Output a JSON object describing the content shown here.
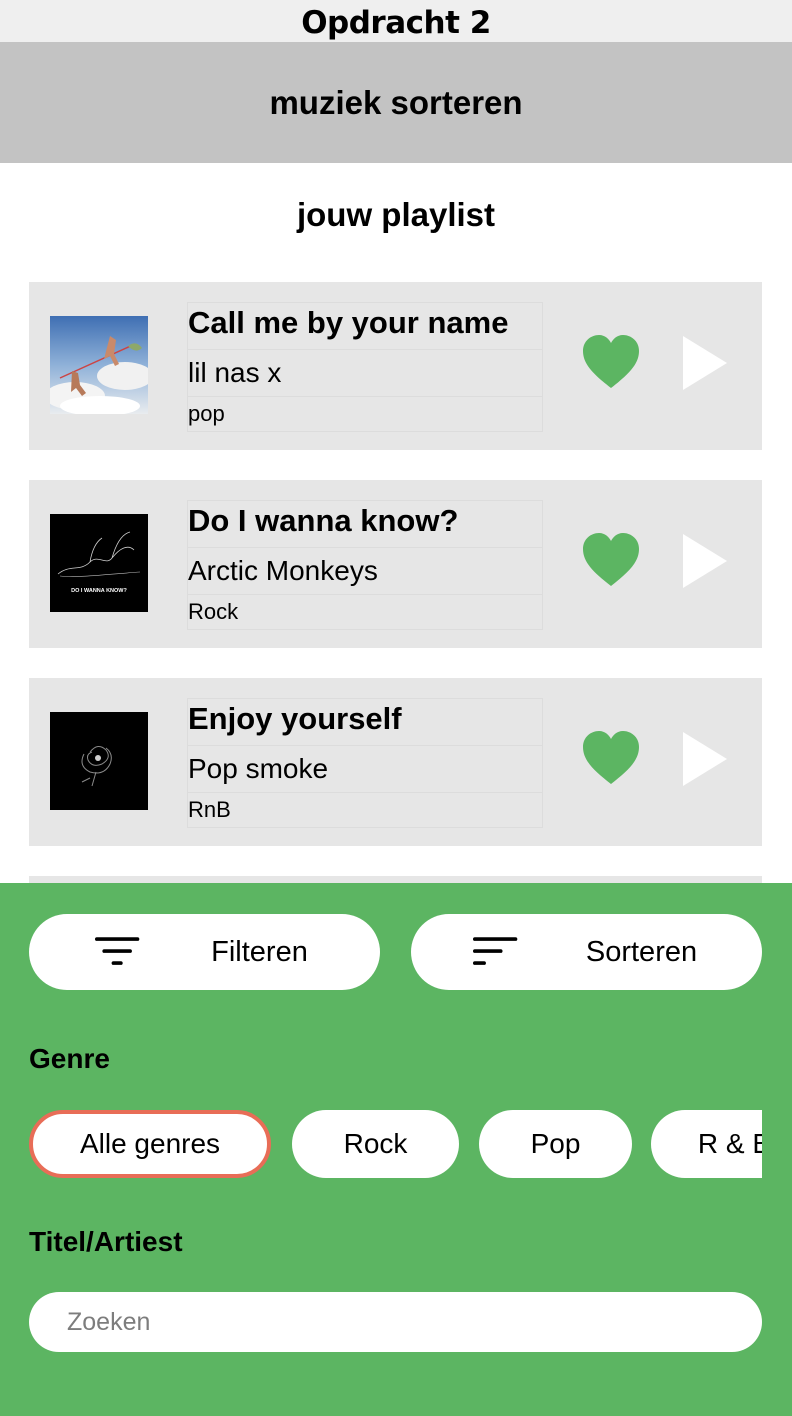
{
  "window": {
    "title": "Opdracht 2"
  },
  "header": {
    "title": "muziek sorteren"
  },
  "playlist": {
    "title": "jouw playlist",
    "songs": [
      {
        "title": "Call me by your name",
        "artist": "lil nas x",
        "genre": "pop",
        "cover": "sky-figures-cover"
      },
      {
        "title": "Do I wanna know?",
        "artist": "Arctic Monkeys",
        "genre": "Rock",
        "cover": "black-line-figure-cover",
        "cover_text": "DO I WANNA KNOW?"
      },
      {
        "title": "Enjoy yourself",
        "artist": "Pop smoke",
        "genre": "RnB",
        "cover": "black-rose-cover"
      }
    ]
  },
  "controls": {
    "filter_label": "Filteren",
    "sort_label": "Sorteren",
    "genre_heading": "Genre",
    "genres": [
      {
        "label": "Alle genres",
        "selected": true
      },
      {
        "label": "Rock",
        "selected": false
      },
      {
        "label": "Pop",
        "selected": false
      },
      {
        "label": "R & B",
        "selected": false
      }
    ],
    "search_heading": "Titel/Artiest",
    "search_placeholder": "Zoeken"
  },
  "colors": {
    "accent_green": "#5cb562",
    "selected_chip_border": "#e86d57",
    "card_bg": "#e6e6e6",
    "header_bg": "#c3c3c3"
  },
  "icons": {
    "like": "heart-icon",
    "play": "play-icon",
    "filter": "filter-icon",
    "sort": "sort-icon"
  }
}
